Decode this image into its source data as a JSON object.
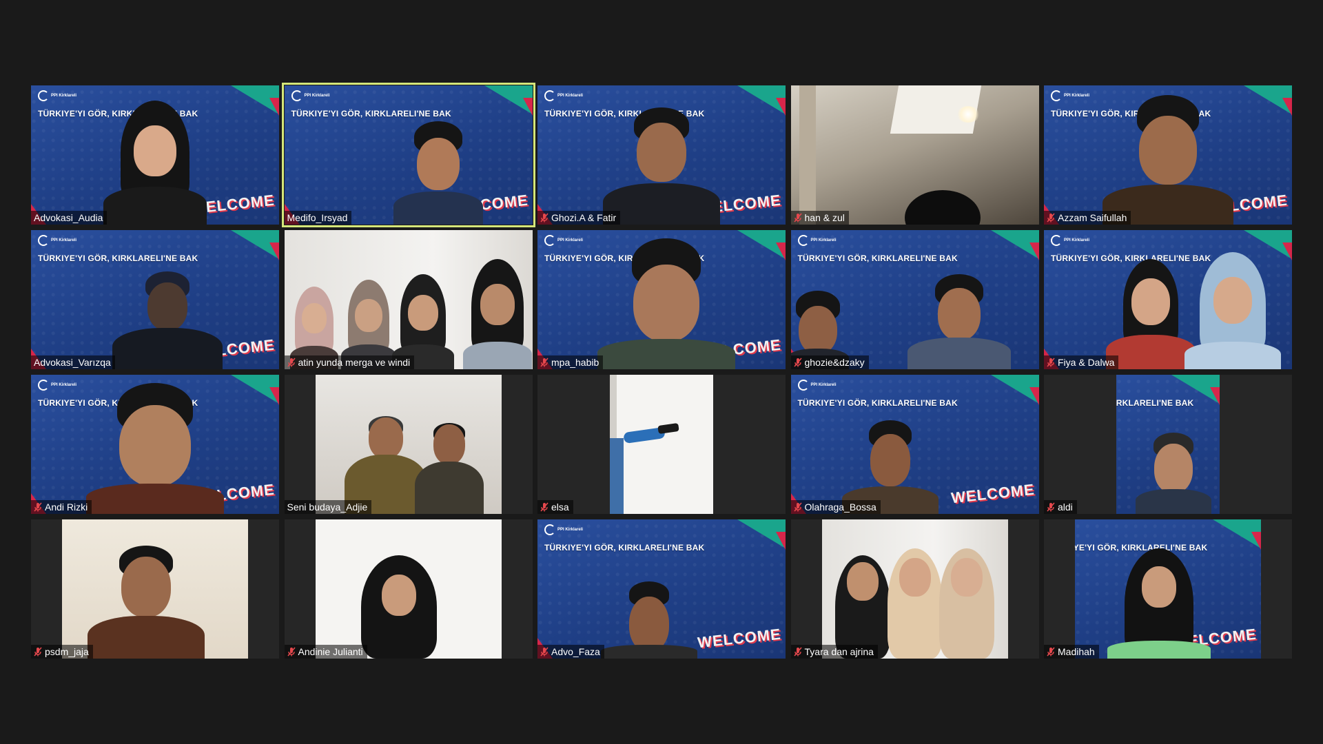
{
  "meeting": {
    "view": "gallery",
    "banner_text": "TÜRKIYE'YI GÖR, KIRKLARELI'NE BAK",
    "welcome_text": "WELCOME",
    "logo_text": "PPI Kirklareli",
    "colors": {
      "active_border": "#d4e67a",
      "mute_icon": "#e5484d",
      "brand_blue": "#24488f"
    },
    "participants": [
      {
        "name": "Advokasi_Audia",
        "muted": false,
        "active": false
      },
      {
        "name": "Medifo_Irsyad",
        "muted": false,
        "active": true
      },
      {
        "name": "Ghozi.A & Fatir",
        "muted": true,
        "active": false
      },
      {
        "name": "han & zul",
        "muted": true,
        "active": false
      },
      {
        "name": "Azzam Saifullah",
        "muted": true,
        "active": false
      },
      {
        "name": "Advokasi_Varızqa",
        "muted": false,
        "active": false
      },
      {
        "name": "atin yunda merga ve windi",
        "muted": true,
        "active": false
      },
      {
        "name": "mpa_habib",
        "muted": true,
        "active": false
      },
      {
        "name": "ghozie&dzaky",
        "muted": true,
        "active": false
      },
      {
        "name": "Fiya & Dalwa",
        "muted": true,
        "active": false
      },
      {
        "name": "Andi Rizki",
        "muted": true,
        "active": false
      },
      {
        "name": "Seni budaya_Adjie",
        "muted": false,
        "active": false
      },
      {
        "name": "elsa",
        "muted": true,
        "active": false
      },
      {
        "name": "Olahraga_Bossa",
        "muted": true,
        "active": false
      },
      {
        "name": "aldi",
        "muted": true,
        "active": false
      },
      {
        "name": "psdm_jaja",
        "muted": true,
        "active": false
      },
      {
        "name": "Andinie Julianti",
        "muted": true,
        "active": false
      },
      {
        "name": "Advo_Faza",
        "muted": true,
        "active": false
      },
      {
        "name": "Tyara dan ajrina",
        "muted": true,
        "active": false
      },
      {
        "name": "Madihah",
        "muted": true,
        "active": false
      }
    ]
  }
}
